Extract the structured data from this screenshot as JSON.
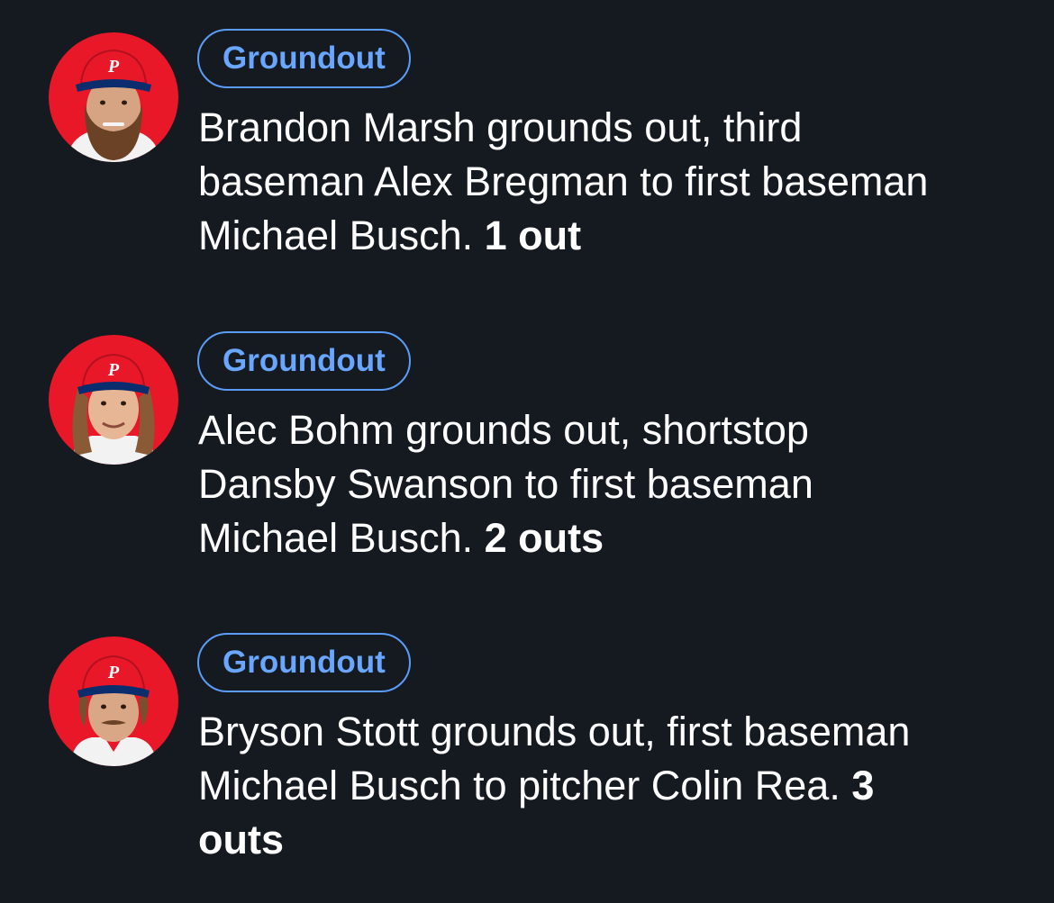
{
  "plays": [
    {
      "player": "Brandon Marsh",
      "avatar_icon": "player-headshot-phillies-bearded",
      "badge": "Groundout",
      "description": "Brandon Marsh grounds out, third baseman Alex Bregman to first baseman Michael Busch.",
      "outs": "1 out"
    },
    {
      "player": "Alec Bohm",
      "avatar_icon": "player-headshot-phillies-long-hair",
      "badge": "Groundout",
      "description": "Alec Bohm grounds out, shortstop Dansby Swanson to first baseman Michael Busch.",
      "outs": "2 outs"
    },
    {
      "player": "Bryson Stott",
      "avatar_icon": "player-headshot-phillies-mustache",
      "badge": "Groundout",
      "description": "Bryson Stott grounds out, first baseman Michael Busch to pitcher Colin Rea.",
      "outs": "3 outs"
    }
  ],
  "colors": {
    "background": "#151a21",
    "badge_accent": "#5b9cf6",
    "avatar_red": "#e81828"
  }
}
